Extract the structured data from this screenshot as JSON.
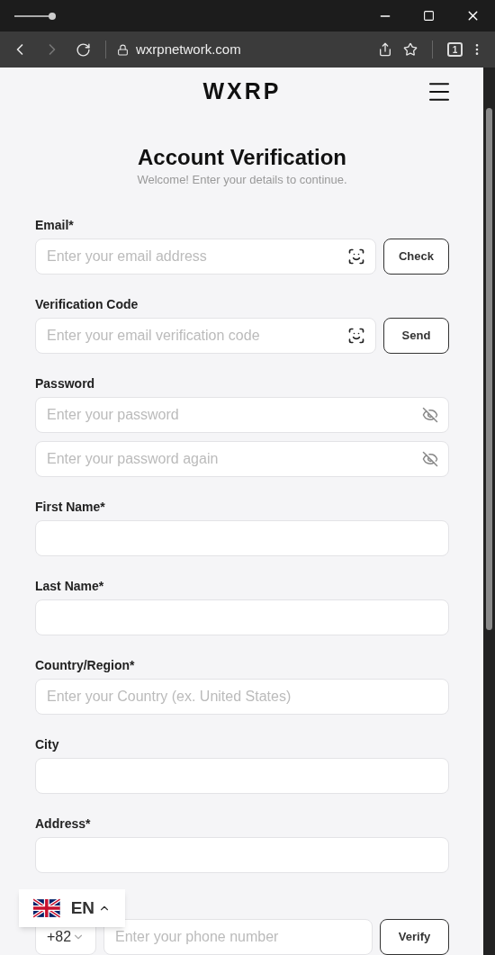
{
  "browser": {
    "url": "wxrpnetwork.com",
    "tab_count": "1",
    "can_go_forward": false
  },
  "header": {
    "logo": "WXRP"
  },
  "heading": {
    "title": "Account Verification",
    "subtitle": "Welcome! Enter your details to continue."
  },
  "sections": [
    {
      "label": "Email*",
      "fields": [
        {
          "kind": "scan",
          "placeholder": "Enter your email address",
          "button": "Check"
        }
      ]
    },
    {
      "label": "Verification Code",
      "fields": [
        {
          "kind": "scan",
          "placeholder": "Enter your email verification code",
          "button": "Send"
        }
      ]
    },
    {
      "label": "Password",
      "fields": [
        {
          "kind": "secret",
          "placeholder": "Enter your password"
        },
        {
          "kind": "secret",
          "placeholder": "Enter your password again"
        }
      ]
    },
    {
      "label": "First Name*",
      "fields": [
        {
          "kind": "plain"
        }
      ]
    },
    {
      "label": "Last Name*",
      "fields": [
        {
          "kind": "plain"
        }
      ]
    },
    {
      "label": "Country/Region*",
      "fields": [
        {
          "kind": "plain",
          "placeholder": "Enter your Country (ex. United States)"
        }
      ]
    },
    {
      "label": "City",
      "fields": [
        {
          "kind": "plain"
        }
      ]
    },
    {
      "label": "Address*",
      "fields": [
        {
          "kind": "plain"
        }
      ]
    },
    {
      "fields": [
        {
          "kind": "phone",
          "country_code": "+82",
          "placeholder": "Enter your phone number",
          "button": "Verify"
        }
      ]
    }
  ],
  "language": {
    "code": "EN",
    "expanded": false
  }
}
